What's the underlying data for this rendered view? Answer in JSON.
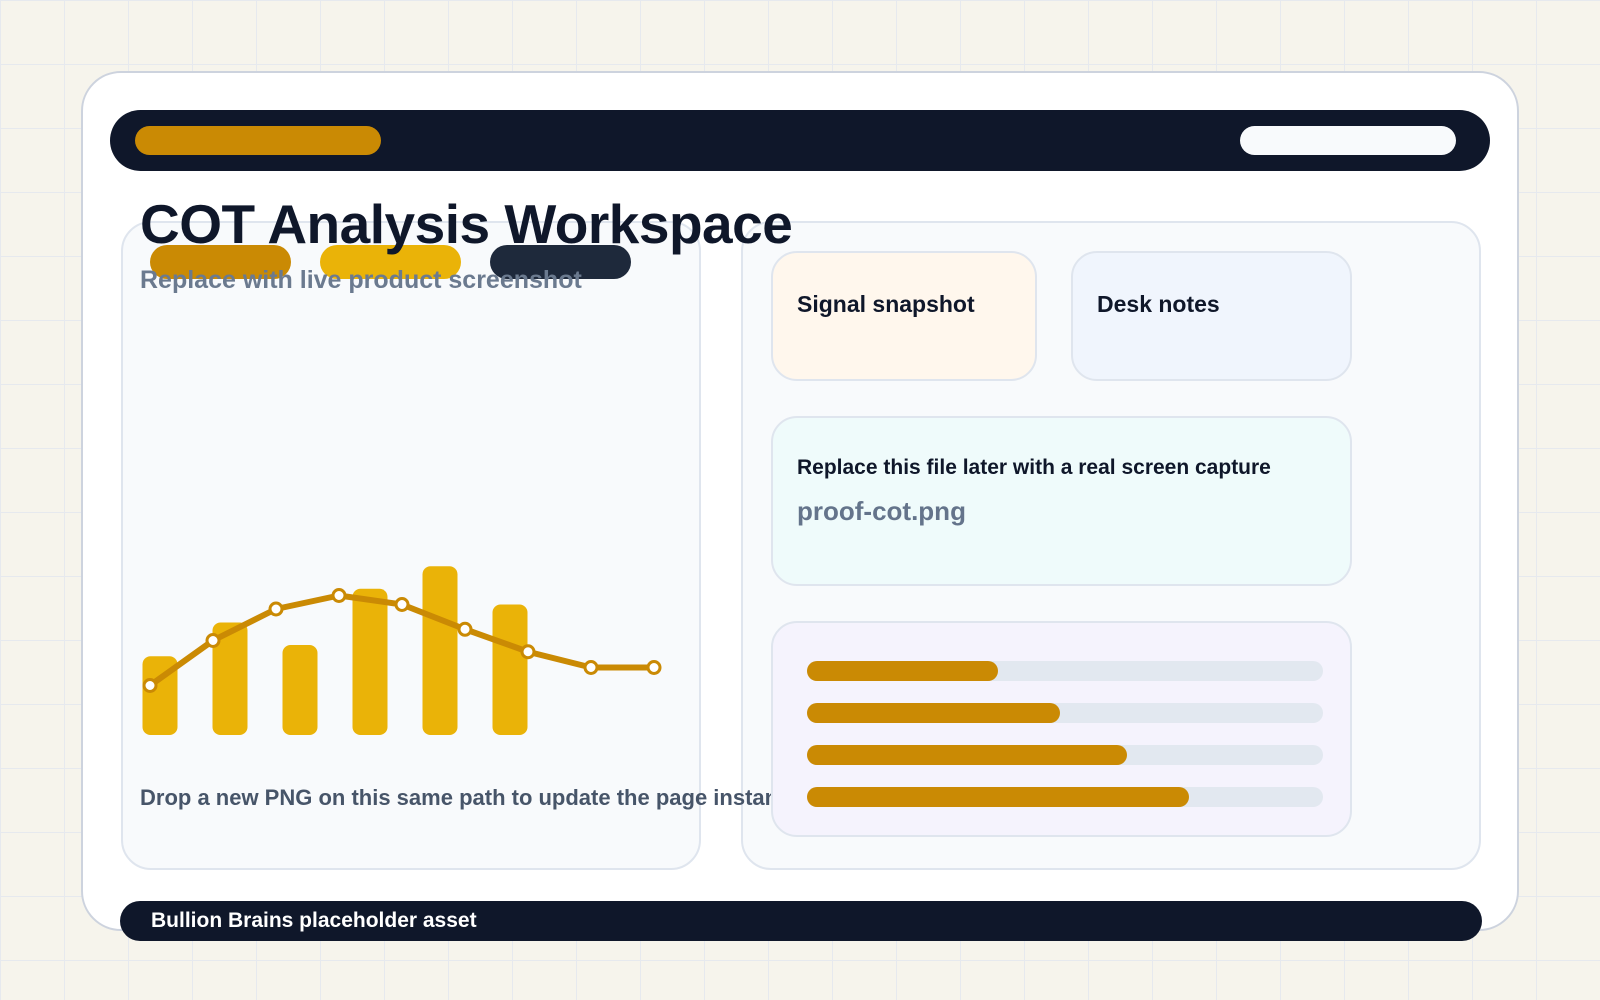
{
  "header": {
    "title": "COT Analysis Workspace",
    "subtitle": "Replace with live product screenshot"
  },
  "colors": {
    "navy": "#0f172a",
    "accent_dark": "#ca8a04",
    "accent_bright": "#eab308",
    "slate": "#1e293b"
  },
  "chart_data": {
    "type": "bar",
    "bars": [
      35,
      50,
      40,
      65,
      75,
      58
    ],
    "line": [
      22,
      42,
      56,
      62,
      58,
      47,
      37,
      30,
      30
    ],
    "ylim": [
      0,
      100
    ]
  },
  "chart_caption": "Drop a new PNG on this same path to update the page instantly.",
  "cards": {
    "signal_title": "Signal snapshot",
    "notes_title": "Desk notes",
    "file_label": "Replace this file later with a real screen capture",
    "file_name": "proof-cot.png"
  },
  "progress": [
    0.37,
    0.49,
    0.62,
    0.74
  ],
  "footer": {
    "text": "Bullion Brains placeholder asset"
  }
}
